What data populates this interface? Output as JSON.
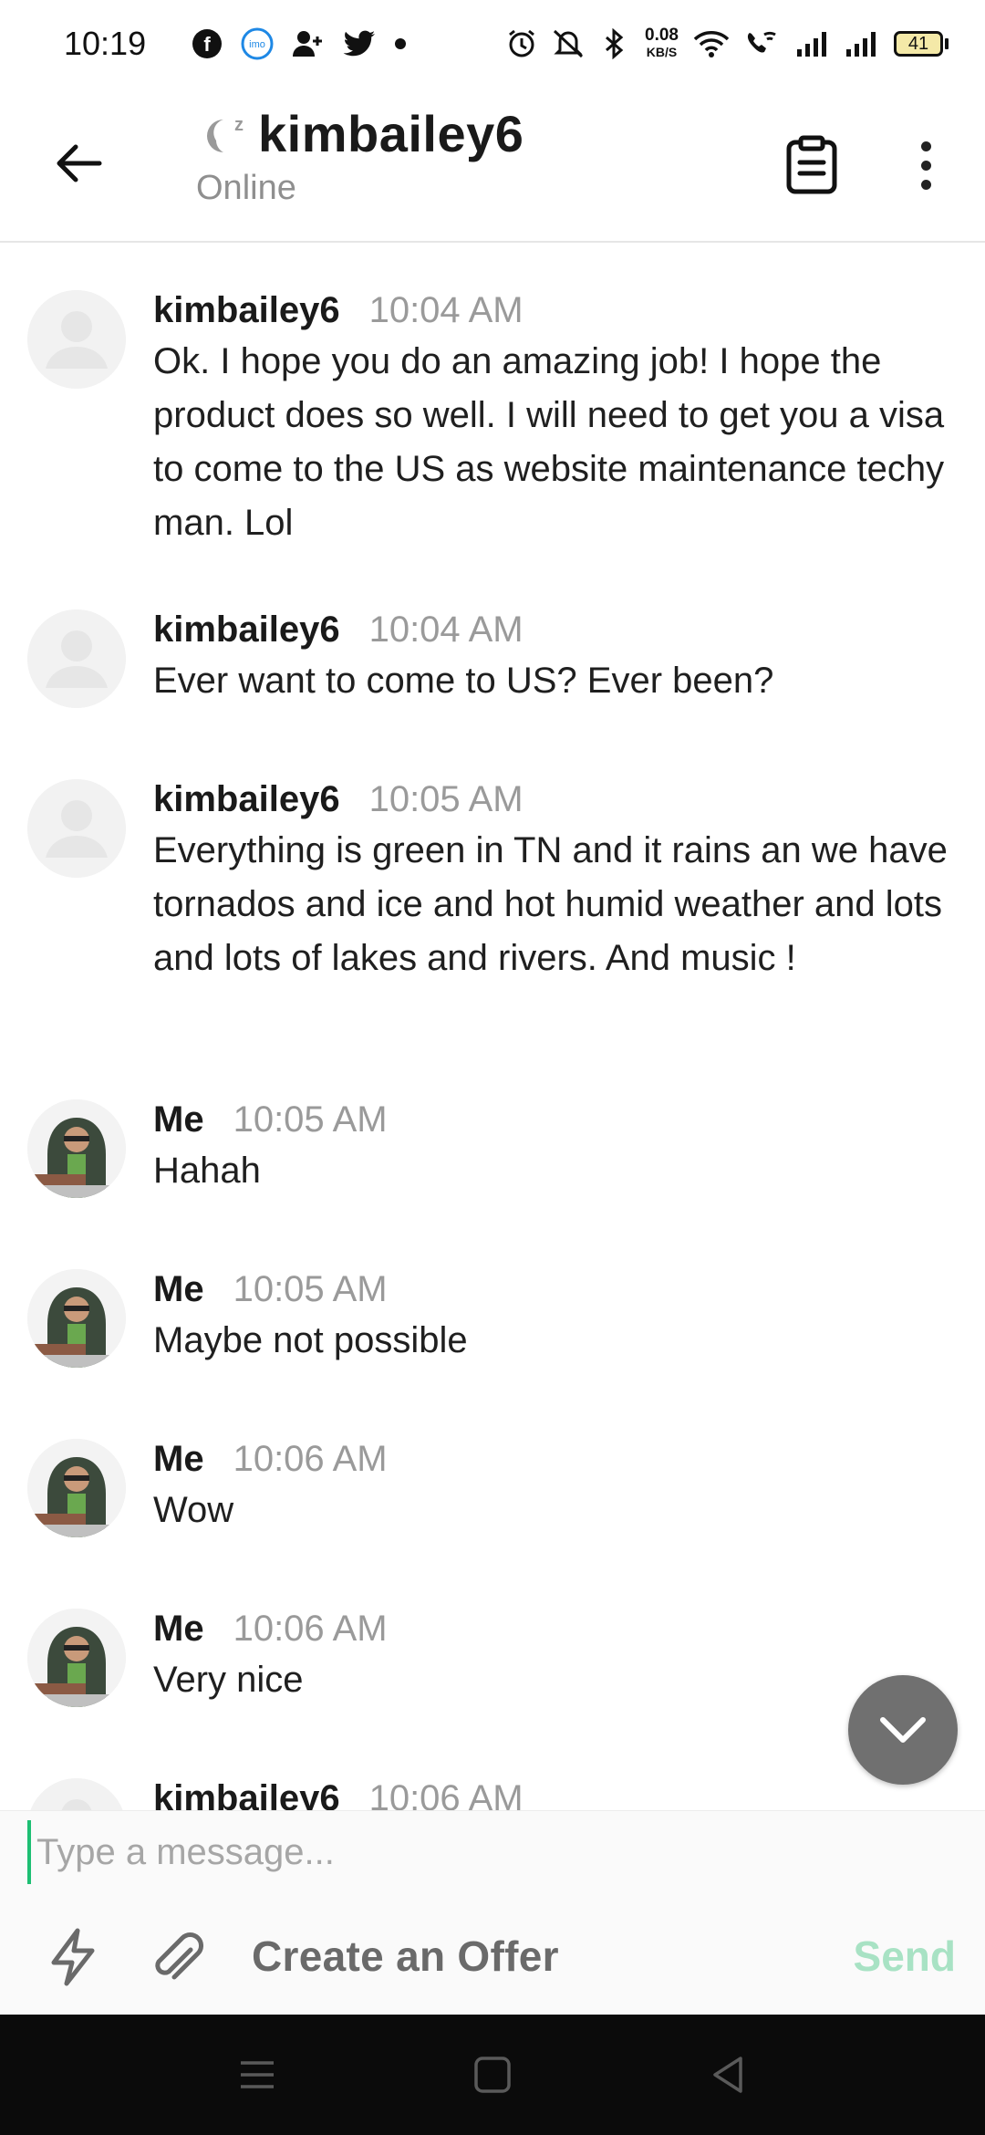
{
  "status_bar": {
    "time": "10:19",
    "net_speed_value": "0.08",
    "net_speed_unit": "KB/S",
    "battery_level": "41"
  },
  "header": {
    "title": "kimbailey6",
    "subtitle": "Online"
  },
  "messages": [
    {
      "sender": "kimbailey6",
      "time": "10:04 AM",
      "text": "Ok. I hope you do an amazing job! I hope the product does so well. I will need to get you a visa to come to the US as website maintenance techy man. Lol",
      "avatar": "placeholder-avatar"
    },
    {
      "sender": "kimbailey6",
      "time": "10:04 AM",
      "text": "Ever want to come to US? Ever been?",
      "avatar": "placeholder-avatar"
    },
    {
      "sender": "kimbailey6",
      "time": "10:05 AM",
      "text": "Everything is green in TN and it rains an we have tornados and ice and hot humid weather and lots and lots of lakes and rivers. And music !",
      "avatar": "placeholder-avatar"
    },
    {
      "sender": "Me",
      "time": "10:05 AM",
      "text": "Hahah",
      "avatar": "user-photo"
    },
    {
      "sender": "Me",
      "time": "10:05 AM",
      "text": "Maybe not possible",
      "avatar": "user-photo"
    },
    {
      "sender": "Me",
      "time": "10:06 AM",
      "text": "Wow",
      "avatar": "user-photo"
    },
    {
      "sender": "Me",
      "time": "10:06 AM",
      "text": "Very nice",
      "avatar": "user-photo"
    },
    {
      "sender": "kimbailey6",
      "time": "10:06 AM",
      "text": "",
      "avatar": "placeholder-avatar"
    }
  ],
  "composer": {
    "placeholder": "Type a message...",
    "offer_label": "Create an Offer",
    "send_label": "Send"
  },
  "colors": {
    "accent": "#1dbf73",
    "send_disabled": "#a8e2c4",
    "fab": "#707070",
    "nav_bar": "#0b0b0b"
  }
}
